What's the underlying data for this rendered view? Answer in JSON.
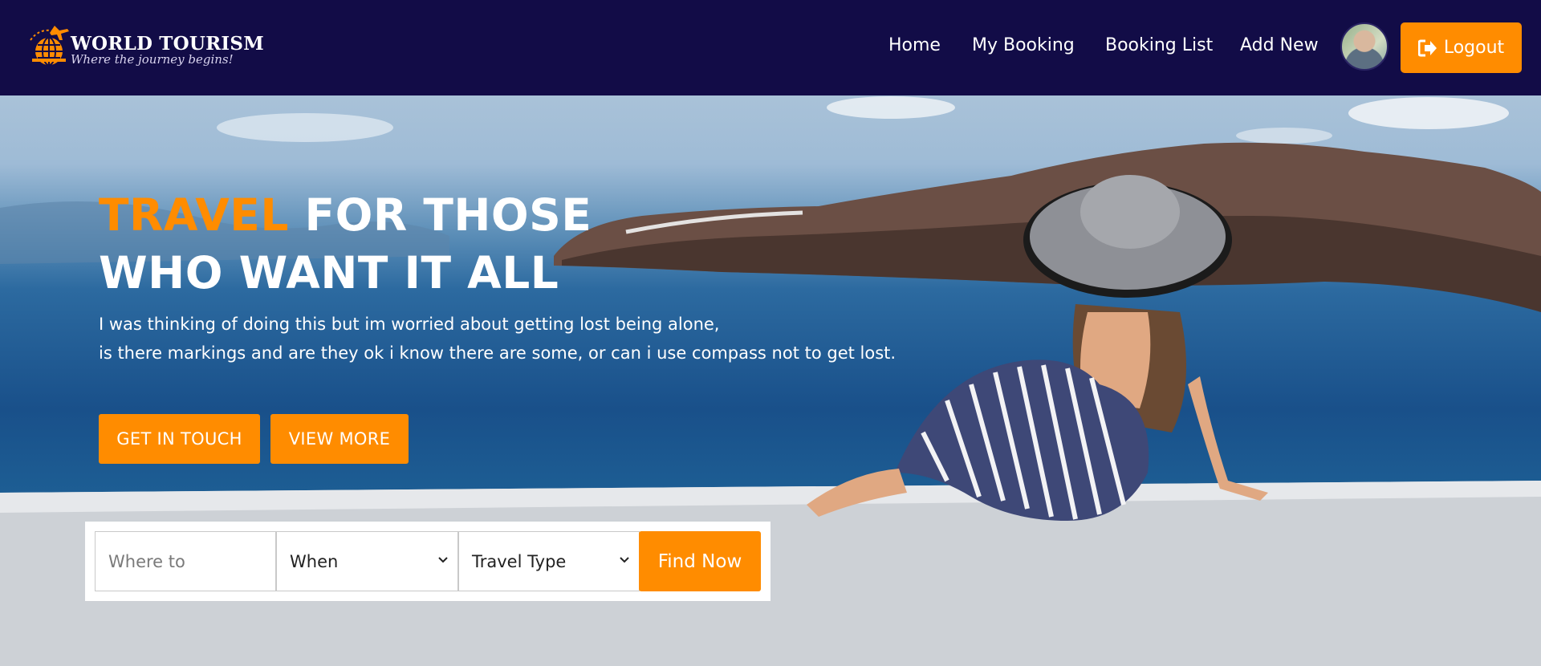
{
  "brand": {
    "name": "WORLD TOURISM",
    "tagline": "Where the journey begins!"
  },
  "nav": {
    "items": [
      "Home",
      "My Booking",
      "Booking List",
      "Add New"
    ],
    "logout_label": "Logout"
  },
  "hero": {
    "title_accent": "TRAVEL",
    "title_line1_rest": " FOR THOSE",
    "title_line2": "WHO WANT IT ALL",
    "desc_line1": "I was thinking of doing this but im worried about getting lost being alone,",
    "desc_line2": "is there markings and are they ok i know there are some, or can i use compass not to get lost.",
    "cta_primary": "GET IN TOUCH",
    "cta_secondary": "VIEW MORE"
  },
  "search": {
    "where_placeholder": "Where to",
    "when_value": "When",
    "type_value": "Travel Type",
    "find_label": "Find Now"
  },
  "colors": {
    "nav_bg": "#120c47",
    "accent": "#ff8c00"
  }
}
